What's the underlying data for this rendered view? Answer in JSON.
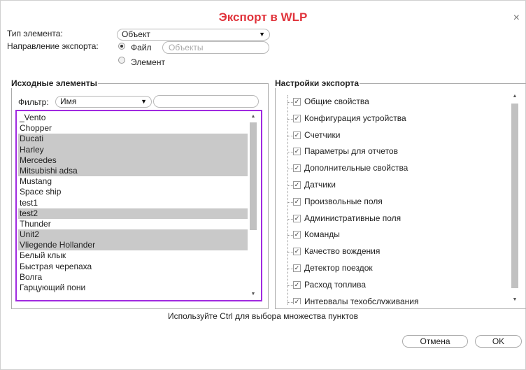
{
  "dialog": {
    "title": "Экспорт в WLP",
    "close": "×"
  },
  "form": {
    "element_type_label": "Тип элемента:",
    "element_type_value": "Объект",
    "direction_label": "Направление экспорта:",
    "direction_file": "Файл",
    "direction_element": "Элемент",
    "file_name_placeholder": "Объекты"
  },
  "source": {
    "legend": "Исходные элементы",
    "filter_label": "Фильтр:",
    "filter_value": "Имя",
    "filter_input": "",
    "items": [
      {
        "label": "_Vento",
        "selected": false
      },
      {
        "label": "Chopper",
        "selected": false
      },
      {
        "label": "Ducati",
        "selected": true
      },
      {
        "label": "Harley",
        "selected": true
      },
      {
        "label": "Mercedes",
        "selected": true
      },
      {
        "label": "Mitsubishi adsa",
        "selected": true
      },
      {
        "label": "Mustang",
        "selected": false
      },
      {
        "label": "Space ship",
        "selected": false
      },
      {
        "label": "test1",
        "selected": false
      },
      {
        "label": "test2",
        "selected": true
      },
      {
        "label": "Thunder",
        "selected": false
      },
      {
        "label": "Unit2",
        "selected": true
      },
      {
        "label": "Vliegende Hollander",
        "selected": true
      },
      {
        "label": "Белый клык",
        "selected": false
      },
      {
        "label": "Быстрая черепаха",
        "selected": false
      },
      {
        "label": "Волга",
        "selected": false
      },
      {
        "label": "Гарцующий пони",
        "selected": false
      }
    ]
  },
  "settings": {
    "legend": "Настройки экспорта",
    "items": [
      {
        "label": "Общие свойства",
        "checked": true
      },
      {
        "label": "Конфигурация устройства",
        "checked": true
      },
      {
        "label": "Счетчики",
        "checked": true
      },
      {
        "label": "Параметры для отчетов",
        "checked": true
      },
      {
        "label": "Дополнительные свойства",
        "checked": true
      },
      {
        "label": "Датчики",
        "checked": true
      },
      {
        "label": "Произвольные поля",
        "checked": true
      },
      {
        "label": "Административные поля",
        "checked": true
      },
      {
        "label": "Команды",
        "checked": true
      },
      {
        "label": "Качество вождения",
        "checked": true
      },
      {
        "label": "Детектор поездок",
        "checked": true
      },
      {
        "label": "Расход топлива",
        "checked": true
      },
      {
        "label": "Интервалы техобслуживания",
        "checked": true
      }
    ]
  },
  "hint": "Используйте Ctrl для выбора множества пунктов",
  "buttons": {
    "cancel": "Отмена",
    "ok": "OK"
  },
  "colors": {
    "title": "#e0343c",
    "list_border": "#a02ae0",
    "selected_row": "#c9c9c9"
  }
}
